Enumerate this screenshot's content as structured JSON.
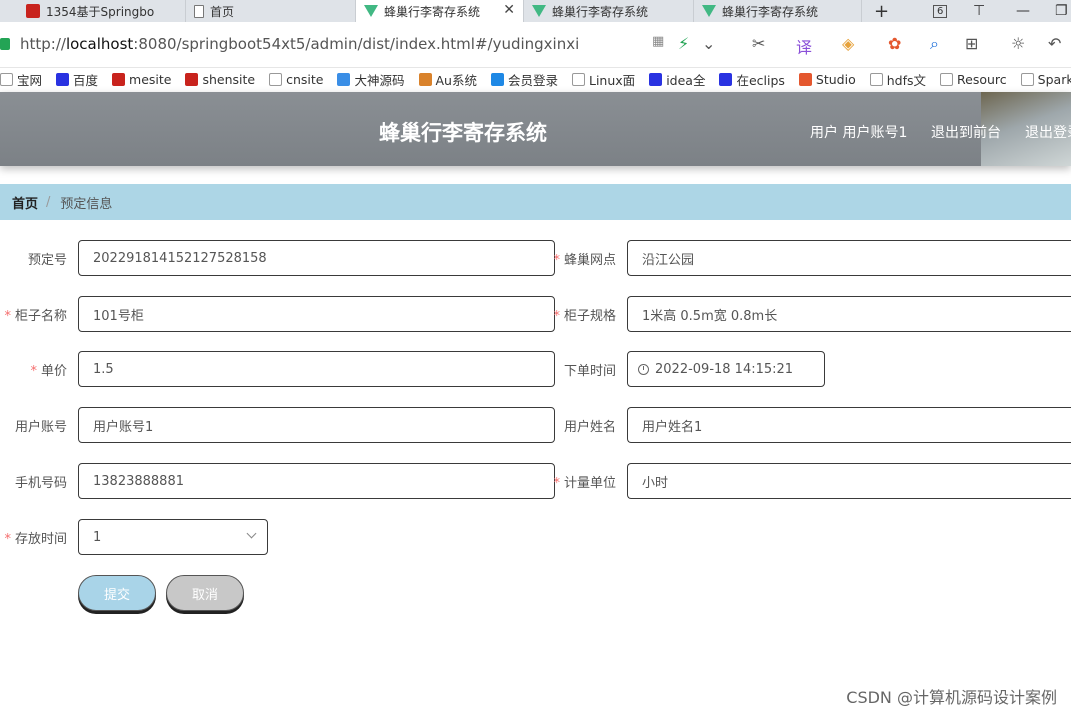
{
  "browser": {
    "tabs": [
      {
        "title": "1354基于Springbo",
        "icon": "red-favicon"
      },
      {
        "title": "首页",
        "icon": "document-icon"
      },
      {
        "title": "蜂巢行李寄存系统",
        "icon": "vue-icon",
        "active": true
      },
      {
        "title": "蜂巢行李寄存系统",
        "icon": "vue-icon"
      },
      {
        "title": "蜂巢行李寄存系统",
        "icon": "vue-icon"
      }
    ],
    "new_tab": "+",
    "tab_count": "6",
    "url_prefix": "http://",
    "url_host": "localhost",
    "url_rest": ":8080/springboot54xt5/admin/dist/index.html#/yudingxinxi",
    "bookmarks": [
      {
        "label": "宝网",
        "color": "#ffffff"
      },
      {
        "label": "百度",
        "color": "#2932e1"
      },
      {
        "label": "mesite",
        "color": "#c8231d"
      },
      {
        "label": "shensite",
        "color": "#c8231d"
      },
      {
        "label": "cnsite",
        "color": "#ffffff"
      },
      {
        "label": "大神源码",
        "color": "#3a8ee6"
      },
      {
        "label": "Au系统",
        "color": "#d9822b"
      },
      {
        "label": "会员登录",
        "color": "#1e88e5"
      },
      {
        "label": "Linux面",
        "color": "#ffffff"
      },
      {
        "label": "idea全",
        "color": "#2932e1"
      },
      {
        "label": "在eclips",
        "color": "#2932e1"
      },
      {
        "label": "Studio",
        "color": "#e4572e"
      },
      {
        "label": "hdfs文",
        "color": "#ffffff"
      },
      {
        "label": "Resourc",
        "color": "#ffffff"
      },
      {
        "label": "SparkSt",
        "color": "#ffffff"
      }
    ]
  },
  "header": {
    "title": "蜂巢行李寄存系统",
    "user": "用户 用户账号1",
    "front": "退出到前台",
    "logout": "退出登录"
  },
  "breadcrumb": {
    "home": "首页",
    "current": "预定信息"
  },
  "form": {
    "order_no": {
      "label": "预定号",
      "value": "2022918141521275281​58",
      "required": false
    },
    "site": {
      "label": "蜂巢网点",
      "value": "沿江公园",
      "required": true
    },
    "cabinet_name": {
      "label": "柜子名称",
      "value": "101号柜",
      "required": true
    },
    "cabinet_spec": {
      "label": "柜子规格",
      "value": "1米高 0.5m宽 0.8m长",
      "required": true
    },
    "price": {
      "label": "单价",
      "value": "1.5",
      "required": true
    },
    "order_time": {
      "label": "下单时间",
      "value": "2022-09-18 14:15:21",
      "required": false
    },
    "account": {
      "label": "用户账号",
      "value": "用户账号1",
      "required": false
    },
    "name": {
      "label": "用户姓名",
      "value": "用户姓名1",
      "required": false
    },
    "phone": {
      "label": "手机号码",
      "value": "13823888881",
      "required": false
    },
    "unit": {
      "label": "计量单位",
      "value": "小时",
      "required": true
    },
    "duration": {
      "label": "存放时间",
      "value": "1",
      "required": true
    },
    "submit": "提交",
    "cancel": "取消"
  },
  "watermark": "CSDN @计算机源码设计案例"
}
